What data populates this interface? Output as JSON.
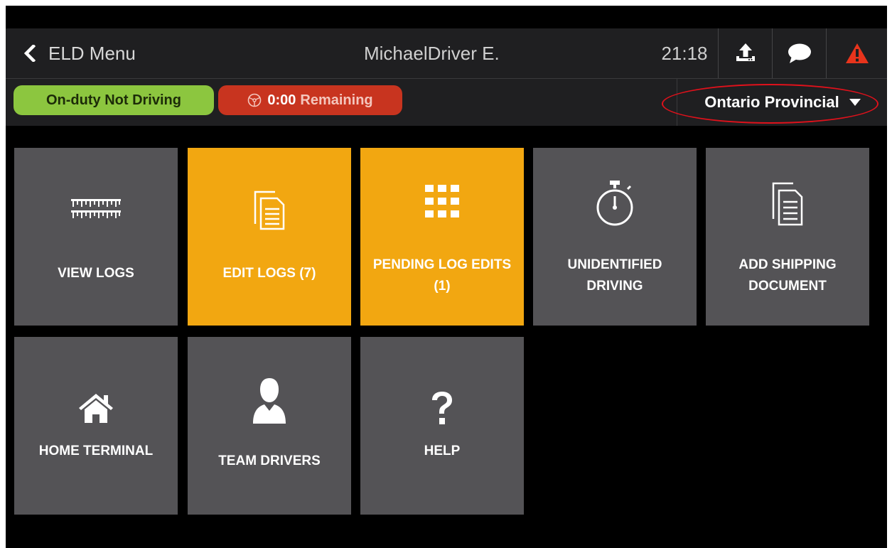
{
  "header": {
    "back_label": "ELD Menu",
    "driver_name": "MichaelDriver E.",
    "time": "21:18"
  },
  "status": {
    "duty_status": "On-duty Not Driving",
    "remaining_time": "0:00",
    "remaining_label": "Remaining",
    "jurisdiction": "Ontario Provincial"
  },
  "tiles": [
    {
      "label": "VIEW LOGS",
      "icon": "ruler-icon",
      "highlighted": false
    },
    {
      "label": "EDIT LOGS (7)",
      "icon": "documents-icon",
      "highlighted": true
    },
    {
      "label": "PENDING LOG EDITS (1)",
      "icon": "grid-icon",
      "highlighted": true
    },
    {
      "label": "UNIDENTIFIED DRIVING",
      "icon": "stopwatch-icon",
      "highlighted": false
    },
    {
      "label": "ADD SHIPPING DOCUMENT",
      "icon": "documents-icon",
      "highlighted": false
    },
    {
      "label": "HOME TERMINAL",
      "icon": "home-icon",
      "highlighted": false
    },
    {
      "label": "TEAM DRIVERS",
      "icon": "person-icon",
      "highlighted": false
    },
    {
      "label": "HELP",
      "icon": "question-icon",
      "highlighted": false
    }
  ],
  "colors": {
    "bar_background": "#1f1f21",
    "tile_gray": "#545356",
    "tile_accent": "#f2a711",
    "on_duty_green": "#8cc63f",
    "remaining_red": "#c8341f",
    "alert_red": "#e8341c",
    "annotation_red": "#e0111b"
  }
}
